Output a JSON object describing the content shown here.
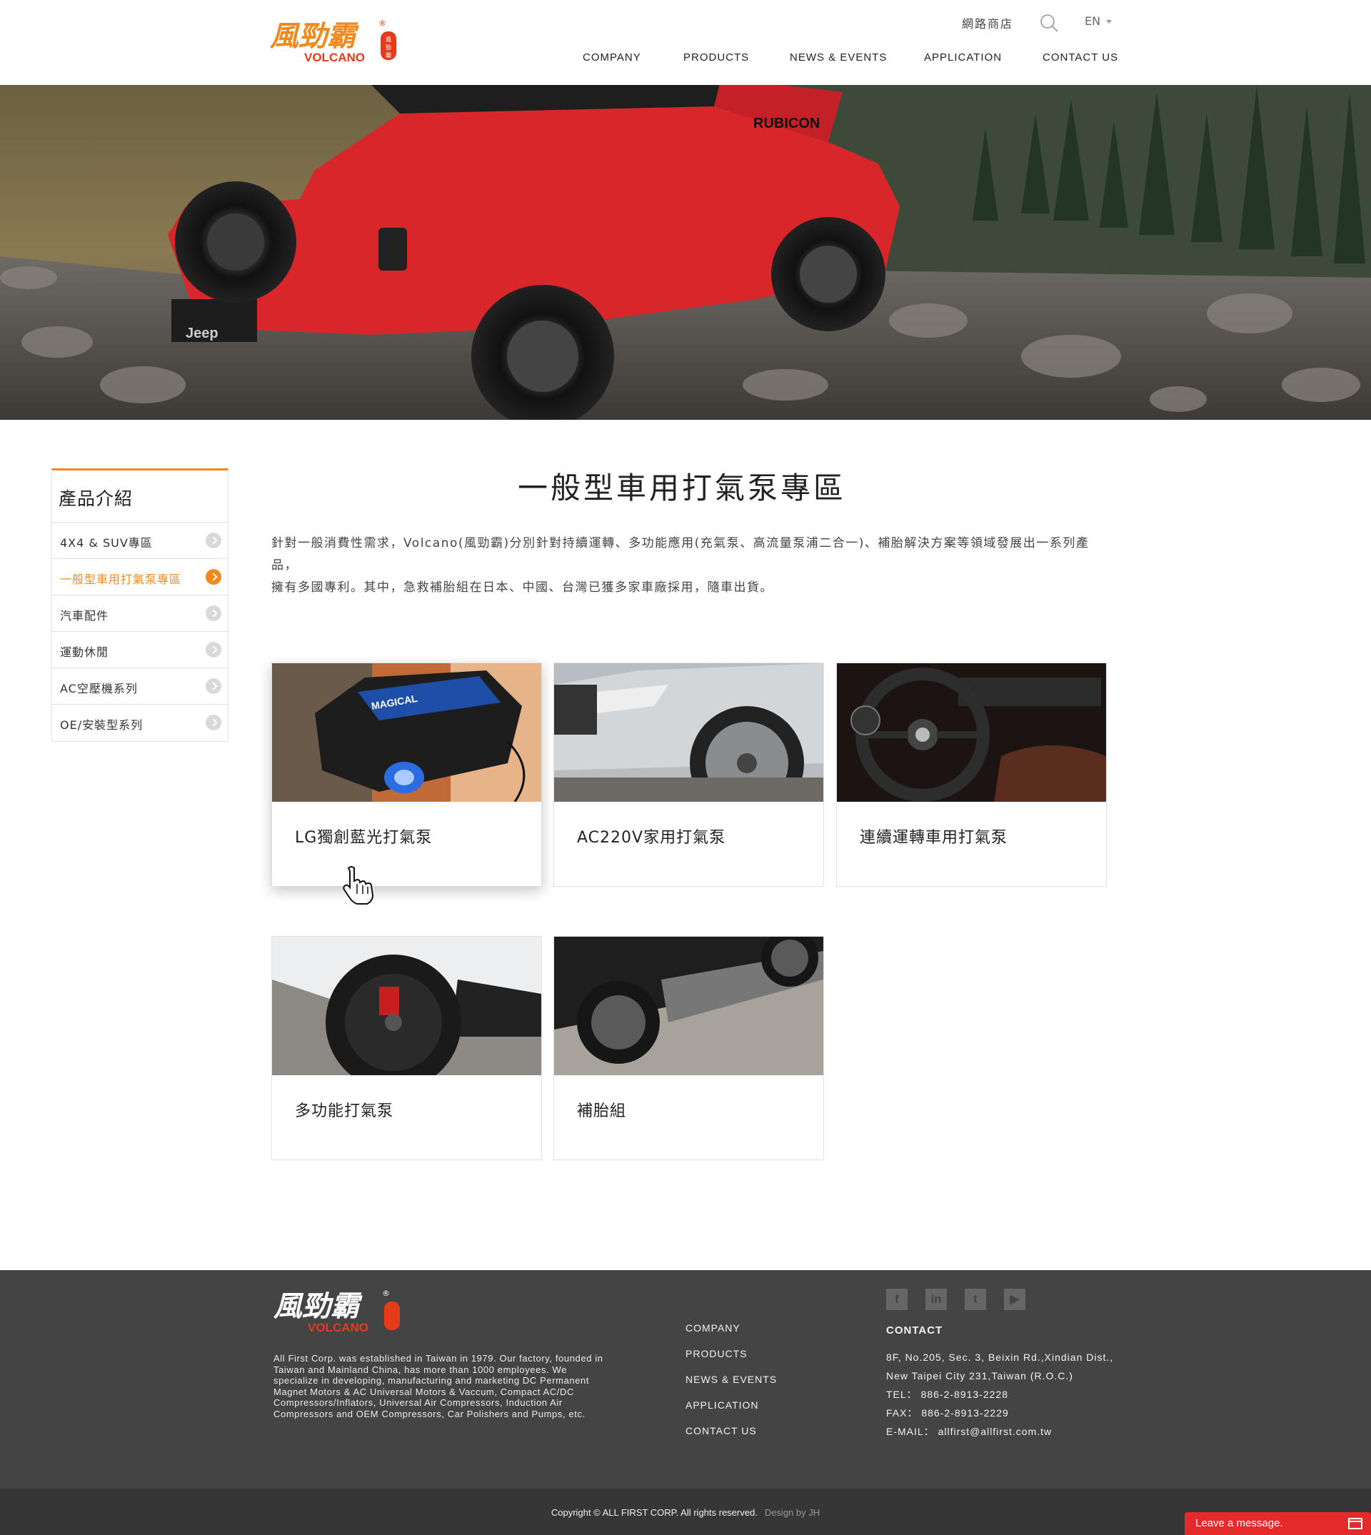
{
  "header": {
    "brand_text": "風勁霸",
    "brand_sub": "VOLCANO",
    "shop_link": "網路商店",
    "language": "EN",
    "nav": [
      "COMPANY",
      "PRODUCTS",
      "NEWS & EVENTS",
      "APPLICATION",
      "CONTACT US"
    ]
  },
  "hero": {
    "image": "red Jeep Wrangler Rubicon on rocky mountain terrain"
  },
  "sidebar": {
    "title": "產品介紹",
    "items": [
      {
        "label": "4X4 & SUV專區",
        "active": false
      },
      {
        "label": "一般型車用打氣泵專區",
        "active": true
      },
      {
        "label": "汽車配件",
        "active": false
      },
      {
        "label": "運動休閒",
        "active": false
      },
      {
        "label": "AC空壓機系列",
        "active": false
      },
      {
        "label": "OE/安裝型系列",
        "active": false
      }
    ]
  },
  "main": {
    "title": "一般型車用打氣泵專區",
    "intro_line1": "針對一般消費性需求，Volcano(風勁霸)分別針對持續運轉、多功能應用(充氣泵、高流量泵浦二合一)、補胎解決方案等領域發展出一系列產品，",
    "intro_line2": "擁有多國專利。其中，急救補胎組在日本、中國、台灣已獲多家車廠採用，隨車出貨。",
    "cards": [
      {
        "label": "LG獨創藍光打氣泵"
      },
      {
        "label": "AC220V家用打氣泵"
      },
      {
        "label": "連續運轉車用打氣泵"
      },
      {
        "label": "多功能打氣泵"
      },
      {
        "label": "補胎組"
      }
    ]
  },
  "footer": {
    "description": "All First Corp. was established in Taiwan in 1979. Our factory, founded in Taiwan and Mainland China, has more than 1000 employees. We specialize in developing, manufacturing and marketing DC Permanent Magnet Motors & AC Universal Motors & Vaccum, Compact AC/DC Compressors/Inflators, Universal Air Compressors, Induction Air Compressors and OEM Compressors, Car Polishers and Pumps, etc.",
    "nav": [
      "COMPANY",
      "PRODUCTS",
      "NEWS & EVENTS",
      "APPLICATION",
      "CONTACT US"
    ],
    "social": [
      "facebook-icon",
      "linkedin-icon",
      "twitter-icon",
      "youtube-icon"
    ],
    "contact_heading": "CONTACT",
    "address_line1": "8F, No.205, Sec. 3, Beixin Rd.,Xindian Dist.,",
    "address_line2": "New Taipei City 231,Taiwan (R.O.C.)",
    "tel": "TEL： 886-2-8913-2228",
    "fax": "FAX： 886-2-8913-2229",
    "email": "E-MAIL： allfirst@allfirst.com.tw",
    "copyright": "Copyright © ALL FIRST CORP. All rights reserved.",
    "design_by": "Design by JH"
  },
  "chat": {
    "label": "Leave a message."
  },
  "colors": {
    "accent": "#f08a1c",
    "footer_bg": "#444444",
    "bottom_bar": "#363636",
    "chat": "#e52a2a"
  }
}
